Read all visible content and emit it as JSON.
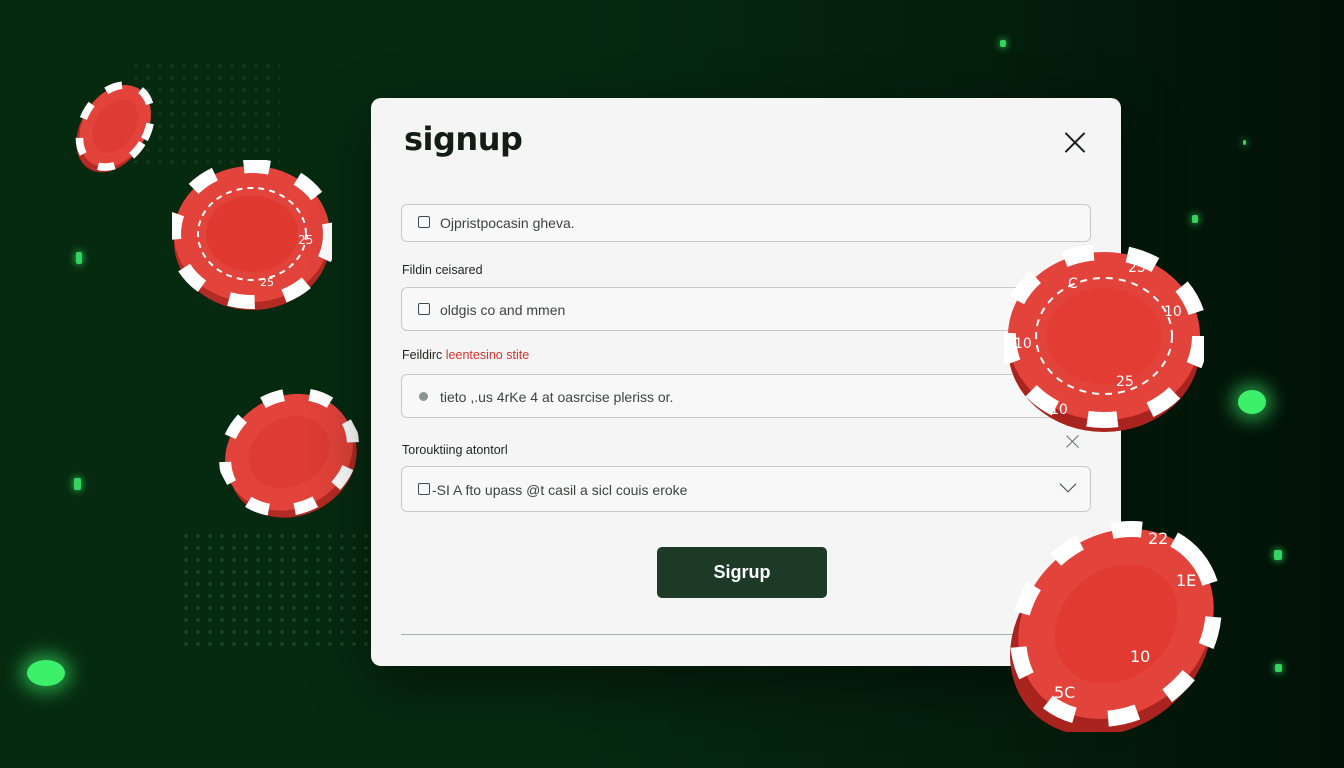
{
  "colors": {
    "accent": "#d9322b",
    "button": "#1d3a27",
    "chip_red": "#e2433a",
    "background_green": "#0f5a1f"
  },
  "modal": {
    "title": "signup",
    "close_icon": "close-icon",
    "fields": [
      {
        "type": "checkbox-input",
        "text": "Ojpristpocasin gheva."
      },
      {
        "type": "checkbox-input",
        "text": "oldgis co and mmen"
      },
      {
        "type": "radio-input",
        "text": "tieto ,.us 4rKe 4 at oasrcise pleriss or."
      },
      {
        "type": "select",
        "text": "-SI A fto upass @t casil a sicl couis eroke"
      }
    ],
    "labels": {
      "label_1": "Fildin ceisared",
      "label_2_main": "Feildirc ",
      "label_2_accent": "leentesino stite",
      "label_3": "Torouktiing atontorl"
    },
    "submit_label": "Sigrup"
  },
  "chips": {
    "top_right_chip": [
      "C",
      "25",
      "10",
      "10",
      "25",
      "10"
    ],
    "bottom_right_chip": [
      "22",
      "1E",
      "10",
      "5C"
    ],
    "left_large_chip": [
      "2",
      "25",
      "25"
    ]
  }
}
